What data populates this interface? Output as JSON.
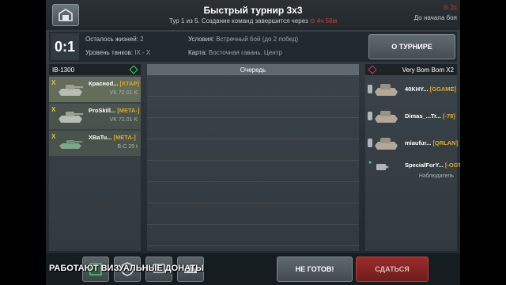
{
  "header": {
    "title": "Быстрый турнир 3x3",
    "subtitle": "Тур 1 из 5. Создание команд завершится через",
    "team_timer": "4ч 58м",
    "battle_timer": "2с",
    "battle_label": "До начала боя"
  },
  "info": {
    "score": "0:1",
    "lives_label": "Осталось жизней:",
    "lives_value": "2",
    "tier_label": "Уровень танков:",
    "tier_value": "IX - X",
    "conditions_label": "Условия:",
    "conditions_value": "Встречный бой (до 2 побед)",
    "map_label": "Карта:",
    "map_value": "Восточная гавань. Центр",
    "tournament_button": "О ТУРНИРЕ"
  },
  "left_team": {
    "name": "IB-1300",
    "players": [
      {
        "mark": "X",
        "name": "Краснod...",
        "clan": "[XTAP]",
        "vehicle": "VK 72.01 K"
      },
      {
        "mark": "X",
        "name": "ProSkill...",
        "clan": "[META-]",
        "vehicle": "VK 72.01 K"
      },
      {
        "mark": "X",
        "name": "XBaTu...",
        "clan": "[META-]",
        "vehicle": "B-C 25 t"
      }
    ]
  },
  "queue": {
    "label": "Очередь"
  },
  "right_team": {
    "name": "Very Bom Bom X2",
    "players": [
      {
        "name": "40KHY...",
        "clan": "[GGAME]"
      },
      {
        "name": "Dimas_...Tr...",
        "clan": "[-78]"
      },
      {
        "name": "miaufur...",
        "clan": "[QRLAN]"
      }
    ],
    "spectator": {
      "name": "SpecialForY...",
      "clan": "[-OGT-]",
      "role": "Наблюдатель"
    }
  },
  "bottom": {
    "not_ready_button": "НЕ ГОТОВ!",
    "surrender_button": "СДАТЬСЯ"
  },
  "overlay_text": "РАБОТАЮТ ВИЗУАЛЬНЫЕ ДОНАТЫ",
  "colors": {
    "accent_red": "#e03b3b",
    "accent_green": "#3fd65a",
    "clan_orange": "#e0a630"
  }
}
